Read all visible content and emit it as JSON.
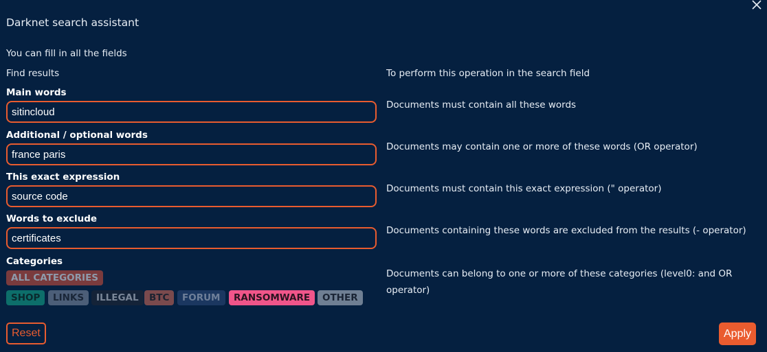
{
  "dialog": {
    "title": "Darknet search assistant",
    "hint": "You can fill in all the fields",
    "left_header": "Find results",
    "right_header": "To perform this operation in the search field",
    "close_icon": "close-icon"
  },
  "fields": [
    {
      "label": "Main words",
      "value": "sitincloud",
      "description": "Documents must contain all these words"
    },
    {
      "label": "Additional / optional words",
      "value": "france paris",
      "description": "Documents may contain one or more of these words (OR operator)"
    },
    {
      "label": "This exact expression",
      "value": "source code",
      "description": "Documents must contain this exact expression (\" operator)"
    },
    {
      "label": "Words to exclude",
      "value": "certificates",
      "description": "Documents containing these words are excluded from the results (- operator)"
    }
  ],
  "categories": {
    "label": "Categories",
    "description": "Documents can belong to one or more of these categories (level0: and OR operator)",
    "all": {
      "label": "ALL CATEGORIES",
      "bg": "#7a3b3d",
      "fg": "#8e9aab"
    },
    "chips": [
      {
        "label": "SHOP",
        "bg": "#0d6e6a",
        "fg": "#0a2a2e"
      },
      {
        "label": "LINKS",
        "bg": "#4c5e78",
        "fg": "#1a2638"
      },
      {
        "label": "ILLEGAL",
        "bg": "#142338",
        "fg": "#7b8798"
      },
      {
        "label": "BTC",
        "bg": "#7a4a4d",
        "fg": "#1c2230"
      },
      {
        "label": "FORUM",
        "bg": "#1b3760",
        "fg": "#6e7f99"
      },
      {
        "label": "RANSOMWARE",
        "bg": "#f0558a",
        "fg": "#2a1420"
      },
      {
        "label": "OTHER",
        "bg": "#6f7f93",
        "fg": "#1a2434"
      }
    ]
  },
  "buttons": {
    "reset": "Reset",
    "apply": "Apply"
  },
  "colors": {
    "background": "#052040",
    "accent": "#ea5c2f"
  }
}
